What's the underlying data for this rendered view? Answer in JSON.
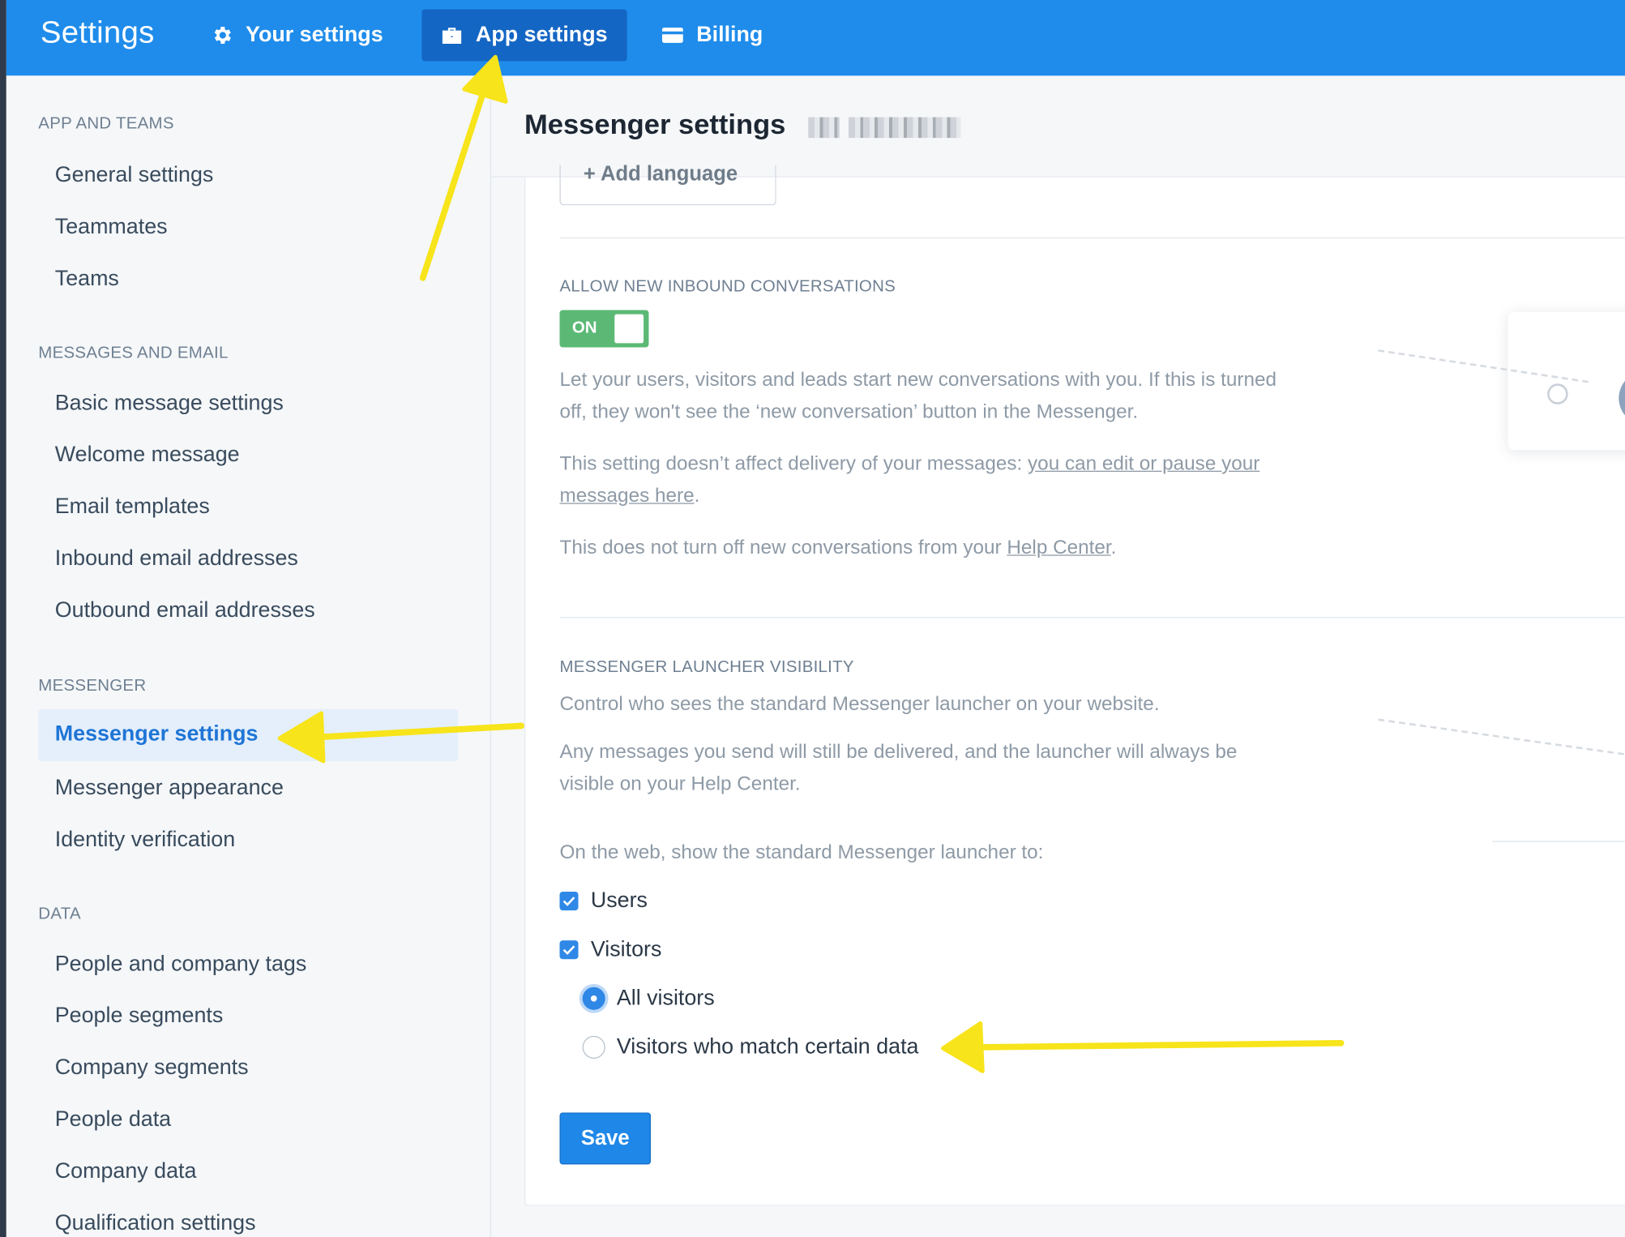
{
  "topbar": {
    "title": "Settings",
    "tabs": [
      {
        "label": "Your settings",
        "icon": "gear-icon"
      },
      {
        "label": "App settings",
        "icon": "briefcase-icon"
      },
      {
        "label": "Billing",
        "icon": "credit-card-icon"
      }
    ]
  },
  "sidebar": {
    "sections": [
      {
        "heading": "APP AND TEAMS",
        "items": [
          "General settings",
          "Teammates",
          "Teams"
        ]
      },
      {
        "heading": "MESSAGES AND EMAIL",
        "items": [
          "Basic message settings",
          "Welcome message",
          "Email templates",
          "Inbound email addresses",
          "Outbound email addresses"
        ]
      },
      {
        "heading": "MESSENGER",
        "items": [
          "Messenger settings",
          "Messenger appearance",
          "Identity verification"
        ]
      },
      {
        "heading": "DATA",
        "items": [
          "People and company tags",
          "People segments",
          "Company segments",
          "People data",
          "Company data",
          "Qualification settings"
        ]
      }
    ],
    "active_item": "Messenger settings"
  },
  "main": {
    "title": "Messenger settings",
    "add_language": "+  Add language",
    "inbound": {
      "heading": "ALLOW NEW INBOUND CONVERSATIONS",
      "toggle_label": "ON",
      "para1": "Let your users, visitors and leads start new conversations with you. If this is turned off, they won't see the ‘new conversation’ button in the Messenger.",
      "para2_text": "This setting doesn’t affect delivery of your messages: ",
      "para2_link": "you can edit or pause your messages here",
      "para2_end": ".",
      "para3_text": "This does not turn off new conversations from your ",
      "para3_link": "Help Center",
      "para3_end": "."
    },
    "launcher": {
      "heading": "MESSENGER LAUNCHER VISIBILITY",
      "para1": "Control who sees the standard Messenger launcher on your website.",
      "para2": "Any messages you send will still be delivered, and the launcher will always be visible on your Help Center.",
      "prompt": "On the web, show the standard Messenger launcher to:",
      "checkboxes": [
        {
          "label": "Users",
          "checked": true
        },
        {
          "label": "Visitors",
          "checked": true
        }
      ],
      "radios": [
        {
          "label": "All visitors",
          "selected": true
        },
        {
          "label": "Visitors who match certain data",
          "selected": false
        }
      ]
    },
    "save_label": "Save"
  },
  "colors": {
    "topbar": "#1f8ceb",
    "active_tab": "#1466c4",
    "accent": "#1f87e8",
    "toggle_on": "#5bb975",
    "annotation_arrow": "#f7e41a"
  }
}
